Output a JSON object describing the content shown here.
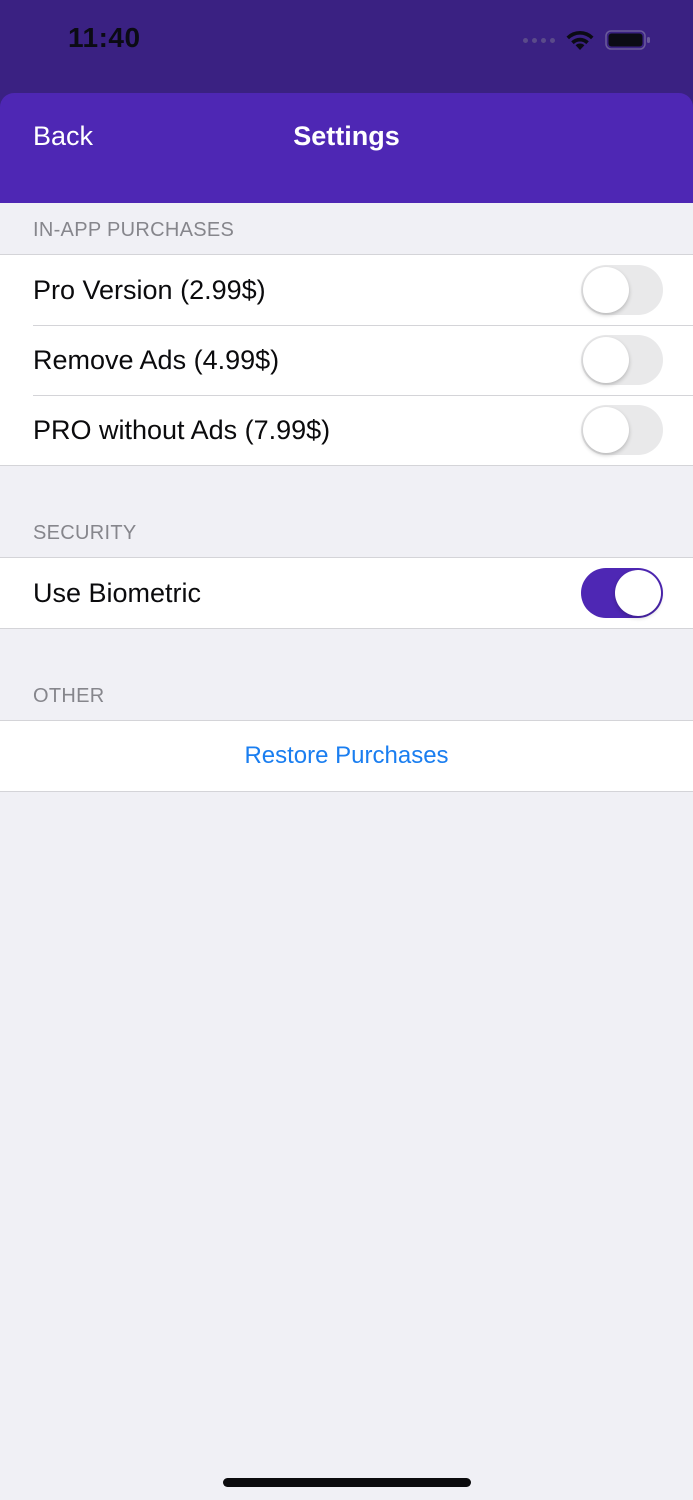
{
  "status_bar": {
    "time": "11:40",
    "icons": [
      "signal-icon",
      "wifi-icon",
      "battery-icon"
    ]
  },
  "nav": {
    "back_label": "Back",
    "title": "Settings"
  },
  "sections": {
    "purchases": {
      "header": "IN-APP PURCHASES",
      "items": [
        {
          "label": "Pro Version (2.99$)",
          "enabled": false
        },
        {
          "label": "Remove Ads (4.99$)",
          "enabled": false
        },
        {
          "label": "PRO without Ads (7.99$)",
          "enabled": false
        }
      ]
    },
    "security": {
      "header": "SECURITY",
      "items": [
        {
          "label": "Use Biometric",
          "enabled": true
        }
      ]
    },
    "other": {
      "header": "OTHER",
      "restore_label": "Restore Purchases"
    }
  },
  "colors": {
    "status_bar_bg": "#3a2182",
    "nav_bg": "#4e27b4",
    "toggle_on": "#4e27b4",
    "link": "#1a7ef0",
    "page_bg": "#f0f0f5"
  }
}
